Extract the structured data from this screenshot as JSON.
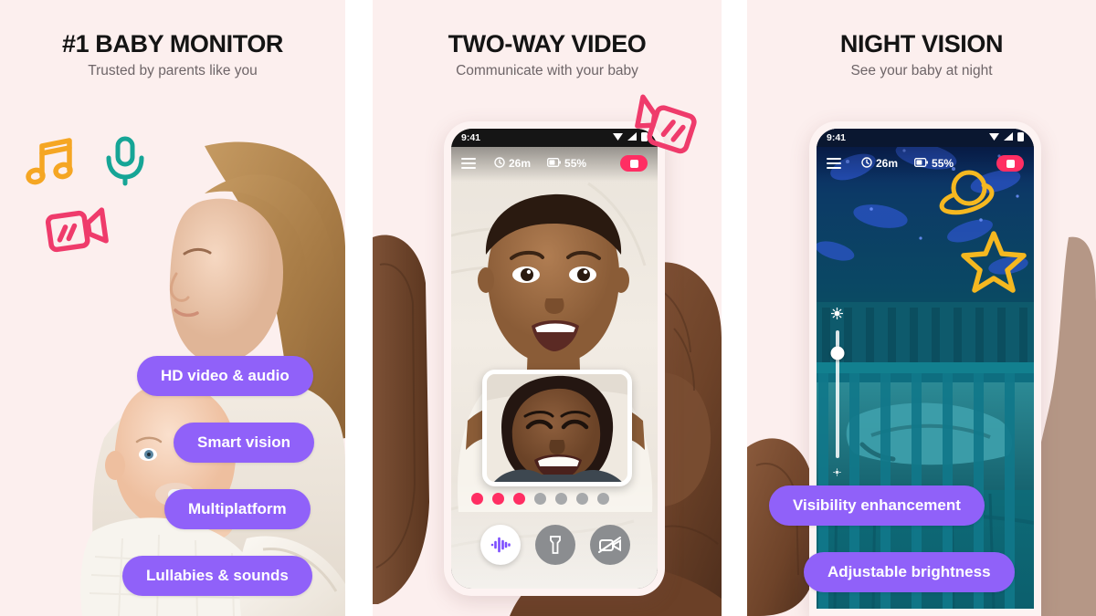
{
  "panels": [
    {
      "headline": "#1 BABY MONITOR",
      "subhead": "Trusted by parents like you",
      "pills": [
        {
          "label": "HD video & audio"
        },
        {
          "label": "Smart vision"
        },
        {
          "label": "Multiplatform"
        },
        {
          "label": "Lullabies & sounds"
        }
      ],
      "doodles": [
        "music-note-icon",
        "microphone-icon",
        "video-camera-icon"
      ],
      "photo_alt": "Mother kissing baby"
    },
    {
      "headline": "TWO-WAY VIDEO",
      "subhead": "Communicate with your baby",
      "doodles": [
        "video-camera-icon"
      ],
      "photo_alt": "Hand holding phone showing baby video call",
      "phone": {
        "status": {
          "time": "9:41",
          "wifi": "wifi-icon",
          "signal": "signal-icon",
          "battery": "battery-icon"
        },
        "appbar": {
          "menu": "hamburger-menu-icon",
          "timer_icon": "clock-icon",
          "timer": "26m",
          "battery_icon": "battery-icon",
          "battery": "55%",
          "record": "record-stop-button"
        },
        "dots": {
          "total": 7,
          "active": 3
        },
        "controls": [
          {
            "name": "audio-waveform-button",
            "state": "active"
          },
          {
            "name": "flashlight-button",
            "state": "inactive"
          },
          {
            "name": "video-off-button",
            "state": "inactive"
          }
        ],
        "pip_alt": "Smiling woman on front camera"
      }
    },
    {
      "headline": "NIGHT VISION",
      "subhead": "See your baby at night",
      "pills": [
        {
          "label": "Visibility enhancement"
        },
        {
          "label": "Adjustable brightness"
        }
      ],
      "doodles": [
        "planet-icon",
        "star-icon"
      ],
      "photo_alt": "Hand holding phone showing night vision crib view",
      "phone": {
        "status": {
          "time": "9:41",
          "wifi": "wifi-icon",
          "signal": "signal-icon",
          "battery": "battery-icon"
        },
        "appbar": {
          "menu": "hamburger-menu-icon",
          "timer_icon": "clock-icon",
          "timer": "26m",
          "battery_icon": "battery-icon",
          "battery": "55%",
          "record": "record-stop-button"
        },
        "brightness": {
          "top_icon": "sun-bright-icon",
          "bottom_icon": "sun-dim-icon",
          "value": 72
        }
      }
    }
  ],
  "colors": {
    "background": "#fcefee",
    "pill": "#9061f9",
    "accent_pink": "#ff2e63",
    "headline": "#141414",
    "subhead": "#6e6568",
    "doodle_orange": "#f5a623",
    "doodle_teal": "#16a596",
    "doodle_pink": "#ef3b6b",
    "doodle_yellow": "#f5b820"
  }
}
